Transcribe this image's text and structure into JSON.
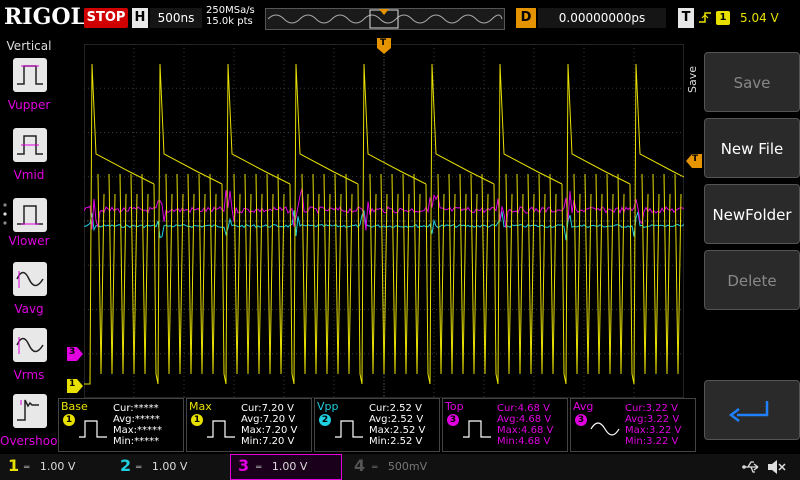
{
  "header": {
    "brand": "RIGOL",
    "run_state": "STOP",
    "timebase_mode": "H",
    "timebase": "500ns",
    "sample_rate": "250MSa/s",
    "memory_points": "15.0k pts",
    "delay_mode": "D",
    "delay": "0.00000000ps",
    "trigger_mode": "T",
    "trigger_edge": "rising-edge-icon",
    "trigger_source": "1",
    "trigger_level": "5.04 V"
  },
  "left_panel": {
    "title": "Vertical",
    "items": [
      {
        "label": "Vupper",
        "icon": "pulse-upper-icon"
      },
      {
        "label": "Vmid",
        "icon": "pulse-mid-icon"
      },
      {
        "label": "Vlower",
        "icon": "pulse-lower-icon"
      },
      {
        "label": "Vavg",
        "icon": "sine-avg-icon"
      },
      {
        "label": "Vrms",
        "icon": "sine-rms-icon"
      },
      {
        "label": "Overshoot",
        "icon": "overshoot-icon"
      }
    ]
  },
  "right_panel": {
    "title": "Save",
    "buttons": [
      {
        "label": "Save",
        "enabled": false
      },
      {
        "label": "New File",
        "enabled": true
      },
      {
        "label": "NewFolder",
        "enabled": true
      },
      {
        "label": "Delete",
        "enabled": false
      }
    ],
    "return_icon": "return-arrow-icon"
  },
  "markers": {
    "trigger_time": "T",
    "trigger_level": "T",
    "ch3_ground": "3",
    "ch1_ground": "1"
  },
  "measurements": [
    {
      "name": "Base",
      "channel": "1",
      "color": "#e8e000",
      "cur": "Cur:*****",
      "avg": "Avg:*****",
      "max": "Max:*****",
      "min": "Min:*****"
    },
    {
      "name": "Max",
      "channel": "1",
      "color": "#e8e000",
      "cur": "Cur:7.20 V",
      "avg": "Avg:7.20 V",
      "max": "Max:7.20 V",
      "min": "Min:7.20 V"
    },
    {
      "name": "Vpp",
      "channel": "2",
      "color": "#20d0e0",
      "cur": "Cur:2.52 V",
      "avg": "Avg:2.52 V",
      "max": "Max:2.52 V",
      "min": "Min:2.52 V"
    },
    {
      "name": "Top",
      "channel": "3",
      "color": "#e000e0",
      "cur": "Cur:4.68 V",
      "avg": "Avg:4.68 V",
      "max": "Max:4.68 V",
      "min": "Min:4.68 V"
    },
    {
      "name": "Avg",
      "channel": "3",
      "color": "#e000e0",
      "cur": "Cur:3.22 V",
      "avg": "Avg:3.22 V",
      "max": "Max:3.22 V",
      "min": "Min:3.22 V"
    }
  ],
  "channels": [
    {
      "num": "1",
      "scale": "1.00 V",
      "color": "#e8e000",
      "active": true
    },
    {
      "num": "2",
      "scale": "1.00 V",
      "color": "#20d0e0",
      "active": true
    },
    {
      "num": "3",
      "scale": "1.00 V",
      "color": "#e000e0",
      "active": true
    },
    {
      "num": "4",
      "scale": "500mV",
      "color": "#555555",
      "active": false
    }
  ],
  "status_icons": [
    "usb-icon",
    "speaker-muted-icon"
  ],
  "colors": {
    "ch1": "#e8e000",
    "ch2": "#20d0e0",
    "ch3": "#e000e0",
    "trigger": "#e59400",
    "stop": "#d10000"
  }
}
